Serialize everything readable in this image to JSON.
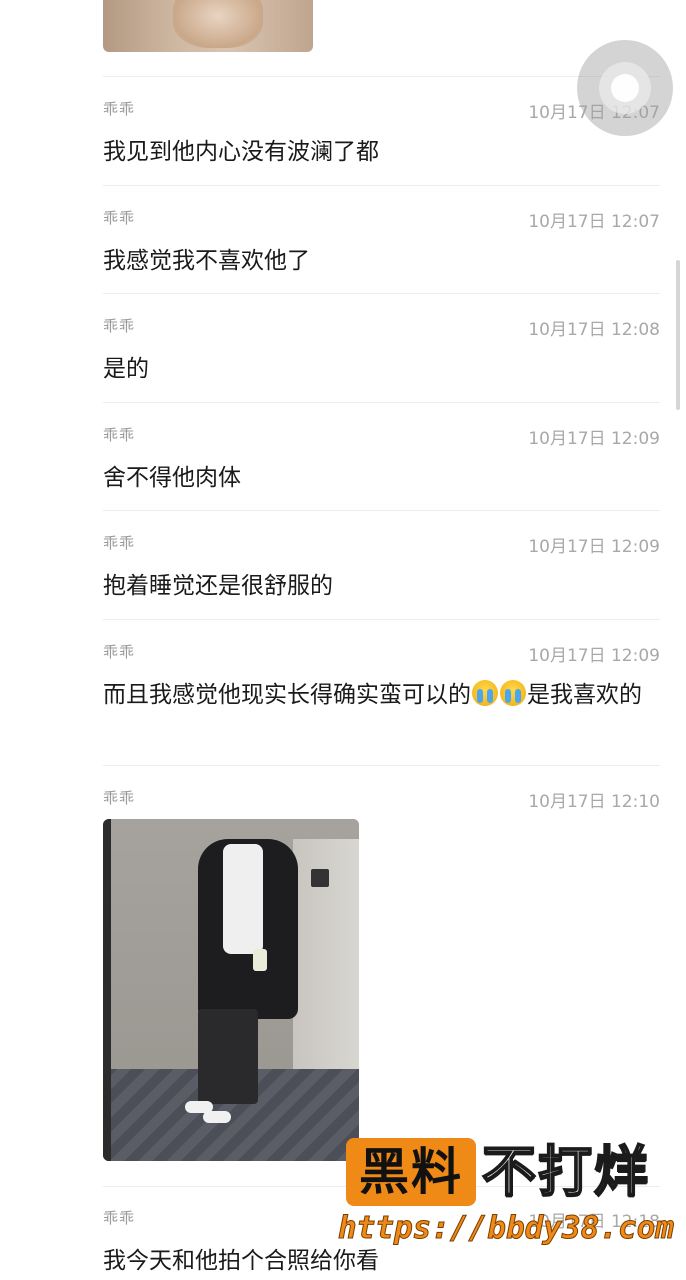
{
  "messages": [
    {
      "sender": "乖乖",
      "time": "10月17日 12:07",
      "text": "我见到他内心没有波澜了都"
    },
    {
      "sender": "乖乖",
      "time": "10月17日 12:07",
      "text": "我感觉我不喜欢他了"
    },
    {
      "sender": "乖乖",
      "time": "10月17日 12:08",
      "text": "是的"
    },
    {
      "sender": "乖乖",
      "time": "10月17日 12:09",
      "text": "舍不得他肉体"
    },
    {
      "sender": "乖乖",
      "time": "10月17日 12:09",
      "text": "抱着睡觉还是很舒服的"
    },
    {
      "sender": "乖乖",
      "time": "10月17日 12:09",
      "text_before": "而且我感觉他现实长得确实蛮可以的",
      "emoji": "crying-face",
      "text_after": "是我喜欢的"
    },
    {
      "sender": "乖乖",
      "time": "10月17日 12:10",
      "image": "photo-person-leaning-on-wall"
    },
    {
      "sender": "乖乖",
      "time": "10月17日 12:18",
      "text": "我今天和他拍个合照给你看"
    }
  ],
  "watermark": {
    "box": "黑料",
    "big": "不打烊",
    "url": "https://bbdy38.com"
  },
  "colors": {
    "watermark_orange": "#f08a17",
    "time_gray": "#a8a8a8",
    "sender_gray": "#9a9a9a"
  }
}
